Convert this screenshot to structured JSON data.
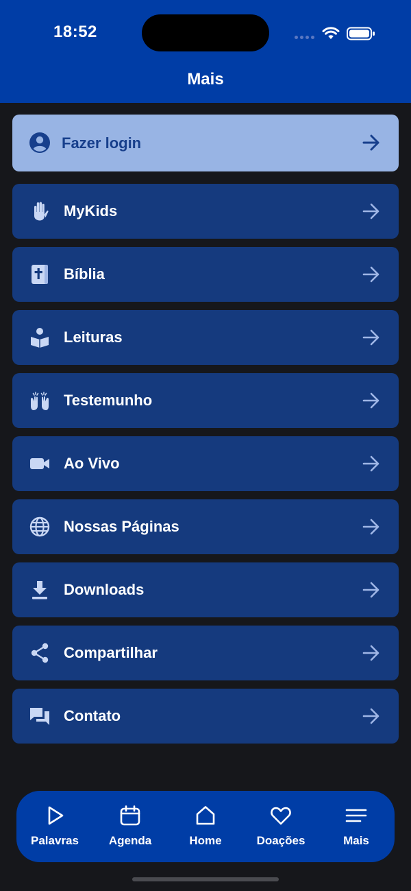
{
  "status_bar": {
    "time": "18:52"
  },
  "header": {
    "title": "Mais"
  },
  "login": {
    "label": "Fazer login",
    "icon": "user-circle-icon",
    "arrow_icon": "arrow-right-icon"
  },
  "menu": {
    "items": [
      {
        "label": "MyKids",
        "icon": "raised-hand-icon"
      },
      {
        "label": "Bíblia",
        "icon": "bible-icon"
      },
      {
        "label": "Leituras",
        "icon": "book-reader-icon"
      },
      {
        "label": "Testemunho",
        "icon": "praying-hands-icon"
      },
      {
        "label": "Ao Vivo",
        "icon": "video-camera-icon"
      },
      {
        "label": "Nossas Páginas",
        "icon": "globe-icon"
      },
      {
        "label": "Downloads",
        "icon": "download-icon"
      },
      {
        "label": "Compartilhar",
        "icon": "share-icon"
      },
      {
        "label": "Contato",
        "icon": "chat-bubbles-icon"
      }
    ]
  },
  "tabbar": {
    "tabs": [
      {
        "label": "Palavras",
        "icon": "play-icon"
      },
      {
        "label": "Agenda",
        "icon": "calendar-icon"
      },
      {
        "label": "Home",
        "icon": "home-icon"
      },
      {
        "label": "Doações",
        "icon": "heart-icon"
      },
      {
        "label": "Mais",
        "icon": "menu-lines-icon"
      }
    ]
  },
  "colors": {
    "header_bg": "#003da6",
    "page_bg": "#16171b",
    "row_bg": "#153a7e",
    "login_bg": "#98b4e4",
    "login_text": "#173f8c",
    "icon_light": "#c9d7f4"
  }
}
